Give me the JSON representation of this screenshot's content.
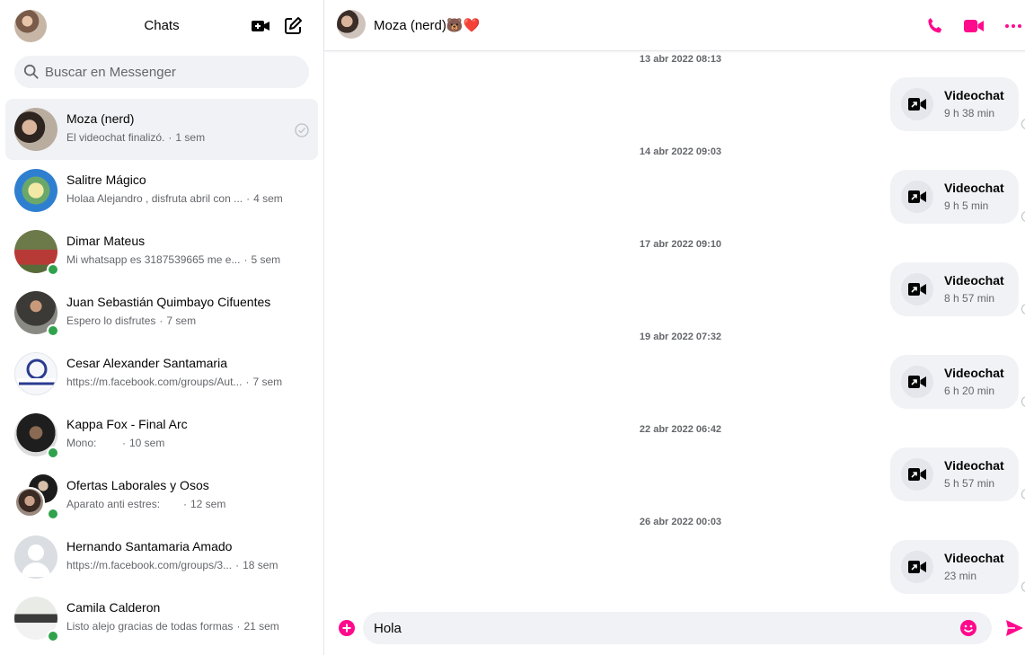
{
  "colors": {
    "accent": "#ff0a8c",
    "online": "#31a24c",
    "muted": "#65676b",
    "bubble": "#f0f2f5"
  },
  "sidebar": {
    "title": "Chats",
    "icons": [
      "new-video-room-icon",
      "compose-icon"
    ],
    "search_placeholder": "Buscar en Messenger",
    "chats": [
      {
        "name": "Moza (nerd)",
        "snippet": "El videochat finalizó.",
        "time": "1 sem",
        "online": false,
        "active": true,
        "read": true
      },
      {
        "name": "Salitre Mágico",
        "snippet": "Holaa Alejandro , disfruta abril con ...",
        "time": "4 sem",
        "online": false
      },
      {
        "name": "Dimar Mateus",
        "snippet": "Mi whatsapp es 3187539665 me e...",
        "time": "5 sem",
        "online": true
      },
      {
        "name": "Juan Sebastián Quimbayo Cifuentes",
        "snippet": "Espero lo disfrutes",
        "time": "7 sem",
        "online": true
      },
      {
        "name": "Cesar Alexander Santamaria",
        "snippet": "https://m.facebook.com/groups/Aut...",
        "time": "7 sem",
        "online": false
      },
      {
        "name": "Kappa Fox - Final Arc",
        "snippet": "Mono:",
        "time": "10 sem",
        "online": true
      },
      {
        "name": "Ofertas Laborales y Osos",
        "snippet": "Aparato anti estres:",
        "time": "12 sem",
        "online": true
      },
      {
        "name": "Hernando Santamaria Amado",
        "snippet": "https://m.facebook.com/groups/3...",
        "time": "18 sem",
        "online": false
      },
      {
        "name": "Camila Calderon",
        "snippet": "Listo alejo gracias de todas formas",
        "time": "21 sem",
        "online": true
      }
    ]
  },
  "conversation": {
    "name": "Moza (nerd)🐻❤️",
    "header_icons": [
      "phone-icon",
      "video-camera-icon",
      "more-options-icon"
    ],
    "messages": [
      {
        "timestamp": "13 abr 2022 08:13",
        "title": "Videochat",
        "duration": "9 h 38 min"
      },
      {
        "timestamp": "14 abr 2022 09:03",
        "title": "Videochat",
        "duration": "9 h 5 min"
      },
      {
        "timestamp": "17 abr 2022 09:10",
        "title": "Videochat",
        "duration": "8 h 57 min"
      },
      {
        "timestamp": "19 abr 2022 07:32",
        "title": "Videochat",
        "duration": "6 h 20 min"
      },
      {
        "timestamp": "22 abr 2022 06:42",
        "title": "Videochat",
        "duration": "5 h 57 min"
      },
      {
        "timestamp": "26 abr 2022 00:03",
        "title": "Videochat",
        "duration": "23 min"
      }
    ],
    "composer": {
      "value": "Hola"
    }
  }
}
